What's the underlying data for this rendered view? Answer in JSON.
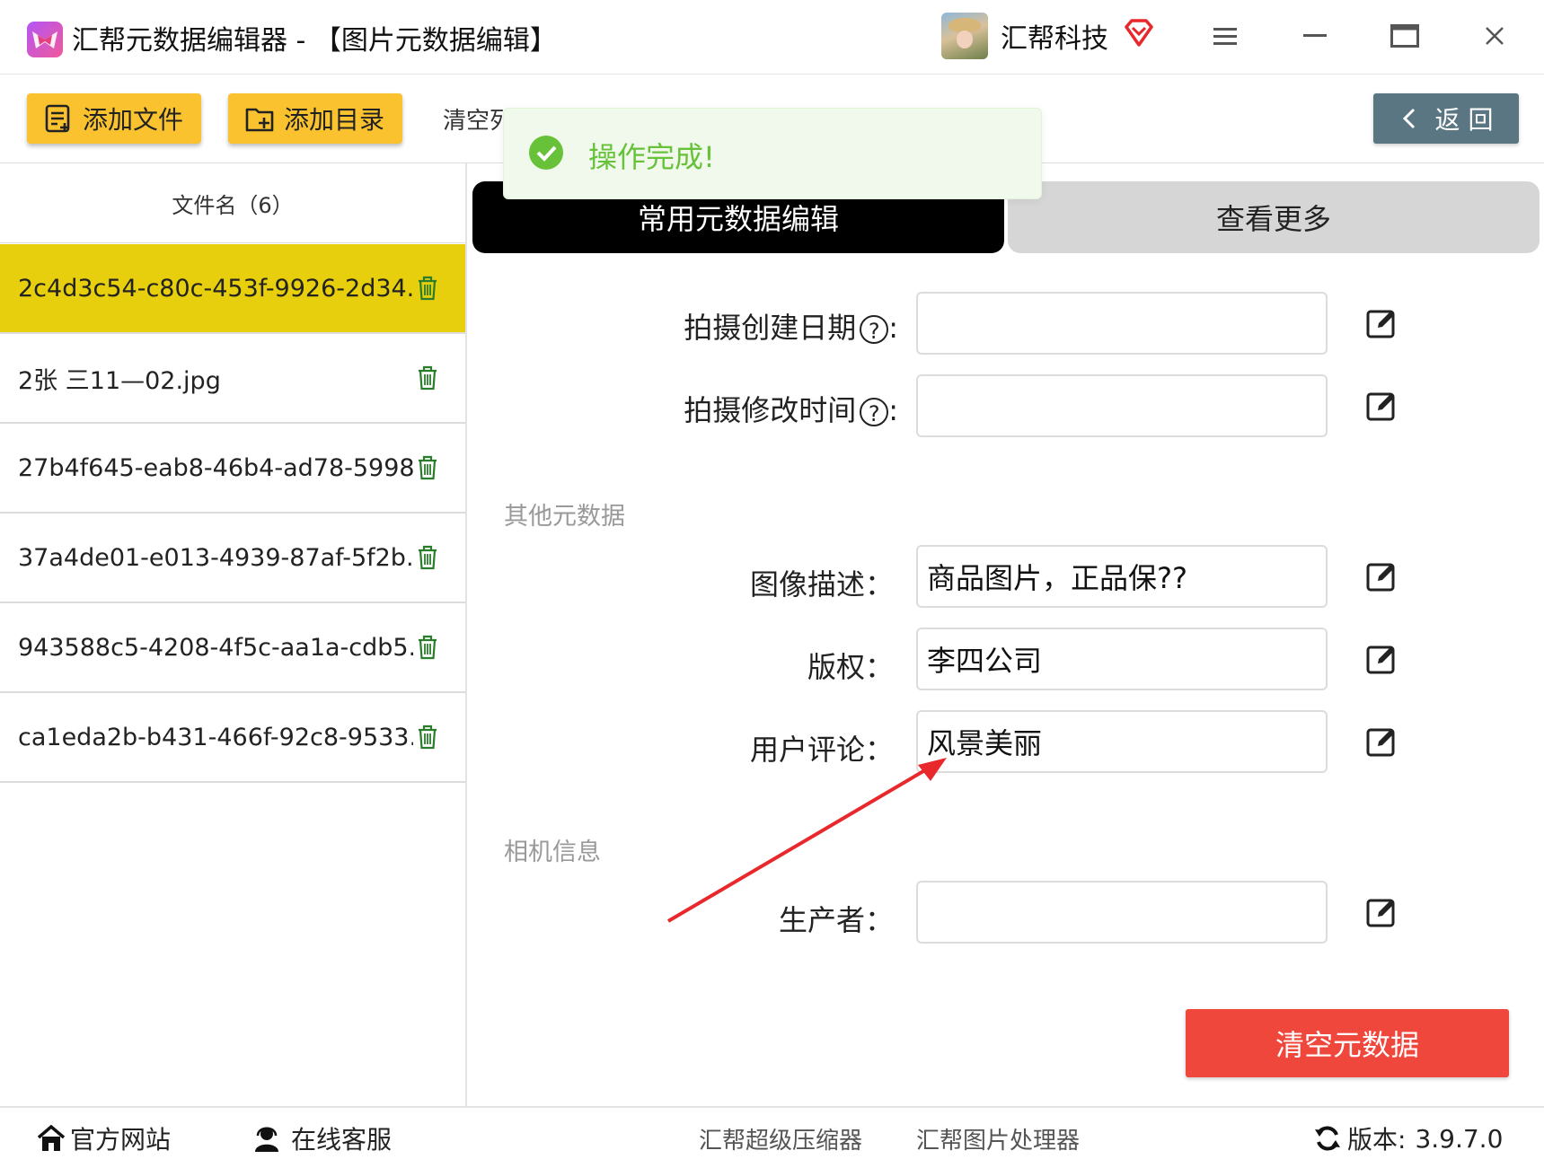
{
  "window": {
    "title": "汇帮元数据编辑器 - 【图片元数据编辑】",
    "user_name": "汇帮科技",
    "icons": {
      "logo": "butterfly-logo-icon",
      "vip": "vip-diamond-icon",
      "menu": "menu-icon",
      "minimize": "minimize-icon",
      "maximize": "maximize-icon",
      "close": "close-icon"
    }
  },
  "toolbar": {
    "add_file_label": "添加文件",
    "add_folder_label": "添加目录",
    "clear_list_label": "清空列",
    "back_label": "返 回",
    "accent_color": "#f9c22e"
  },
  "toast": {
    "text": "操作完成!",
    "color": "#67c23a"
  },
  "file_list": {
    "header": "文件名（6）",
    "files": [
      {
        "name": "2c4d3c54-c80c-453f-9926-2d34..",
        "selected": true
      },
      {
        "name": "2张 三11—02.jpg",
        "selected": false
      },
      {
        "name": "27b4f645-eab8-46b4-ad78-5998..",
        "selected": false
      },
      {
        "name": "37a4de01-e013-4939-87af-5f2b..",
        "selected": false
      },
      {
        "name": "943588c5-4208-4f5c-aa1a-cdb5..",
        "selected": false
      },
      {
        "name": "ca1eda2b-b431-466f-92c8-9533..",
        "selected": false
      }
    ]
  },
  "tabs": {
    "common": "常用元数据编辑",
    "more": "查看更多"
  },
  "form": {
    "fields_top": [
      {
        "label": "拍摄创建日期",
        "help": "?",
        "value": ""
      },
      {
        "label": "拍摄修改时间",
        "help": "?",
        "value": ""
      }
    ],
    "section_other": "其他元数据",
    "fields_other": [
      {
        "label": "图像描述：",
        "value": "商品图片，正品保??"
      },
      {
        "label": "版权：",
        "value": "李四公司"
      },
      {
        "label": "用户评论：",
        "value": "风景美丽"
      }
    ],
    "section_camera": "相机信息",
    "fields_camera": [
      {
        "label": "生产者：",
        "value": ""
      }
    ],
    "clear_button": "清空元数据",
    "clear_color": "#ef473c"
  },
  "footer": {
    "website": "官方网站",
    "support": "在线客服",
    "link_compressor": "汇帮超级压缩器",
    "link_image": "汇帮图片处理器",
    "version_label": "版本:",
    "version_value": "3.9.7.0"
  }
}
